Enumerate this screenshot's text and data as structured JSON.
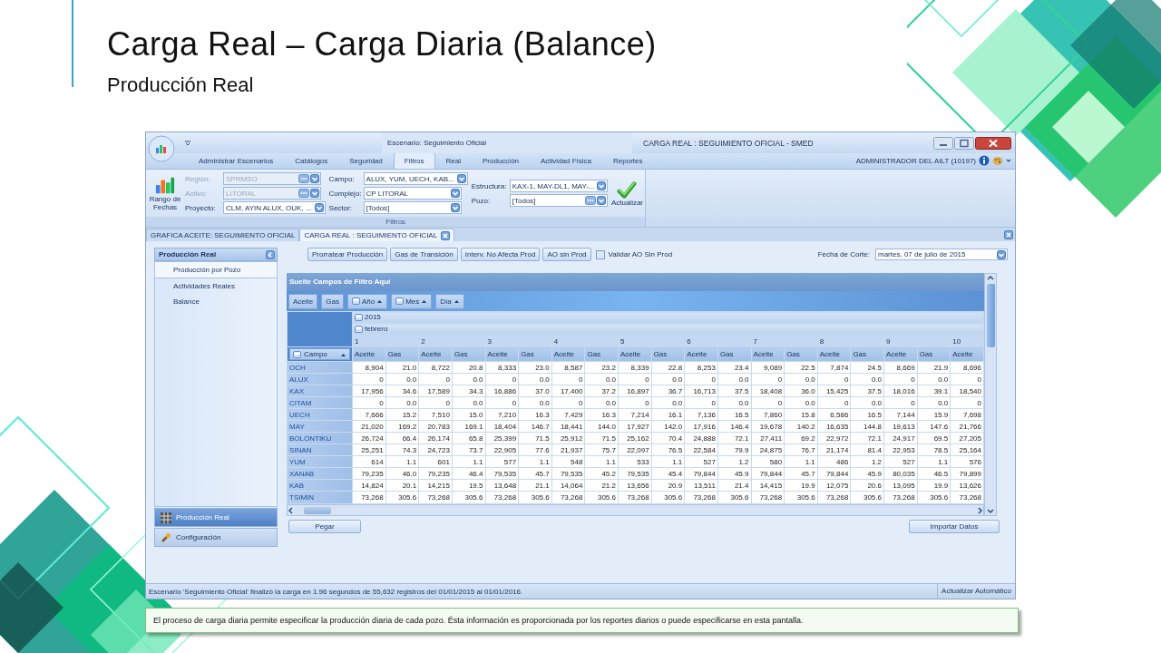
{
  "slide": {
    "title": "Carga Real – Carga Diaria (Balance)",
    "subtitle": "Producción Real"
  },
  "window": {
    "scenario": "Escenario: Seguimiento Oficial",
    "title": "CARGA REAL : SEGUIMIENTO OFICIAL - SMED"
  },
  "ribbon_tabs": [
    {
      "label": "Administrar Escenarios",
      "selected": false
    },
    {
      "label": "Catálogos",
      "selected": false
    },
    {
      "label": "Seguridad",
      "selected": false
    },
    {
      "label": "Filtros",
      "selected": true
    },
    {
      "label": "Real",
      "selected": false
    },
    {
      "label": "Producción",
      "selected": false
    },
    {
      "label": "Actividad Física",
      "selected": false
    },
    {
      "label": "Reportes",
      "selected": false
    }
  ],
  "user": "ADMINISTRADOR DEL AILT (10197)",
  "filters": {
    "date_range_button": "Rango de Fechas",
    "group_label": "Filtros",
    "update_button": "Actualizar",
    "columns": [
      [
        {
          "label": "Región:",
          "value": "SPRMSO",
          "kind": "lookup",
          "disabled": true
        },
        {
          "label": "Activo:",
          "value": "LITORAL",
          "kind": "lookup",
          "disabled": true
        },
        {
          "label": "Proyecto:",
          "value": "CLM, AYIN ALUX, OUK, ...",
          "kind": "combo",
          "disabled": false
        }
      ],
      [
        {
          "label": "Campo:",
          "value": "ALUX, YUM, UECH, KAB...",
          "kind": "combo",
          "disabled": false
        },
        {
          "label": "Complejo:",
          "value": "CP LITORAL",
          "kind": "combo",
          "disabled": false
        },
        {
          "label": "Sector:",
          "value": "[Todos]",
          "kind": "combo",
          "disabled": false
        }
      ],
      [
        {
          "label": "Estructura:",
          "value": "KAX-1, MAY-DL1, MAY-...",
          "kind": "combo",
          "disabled": false
        },
        {
          "label": "Pozo:",
          "value": "[Todos]",
          "kind": "lookup",
          "disabled": false
        }
      ]
    ]
  },
  "doc_tabs": [
    {
      "label": "GRAFICA ACEITE: SEGUIMIENTO OFICIAL",
      "selected": false,
      "closable": false
    },
    {
      "label": "CARGA REAL : SEGUIMIENTO OFICIAL",
      "selected": true,
      "closable": true
    }
  ],
  "sidebar": {
    "header": "Producción Real",
    "items": [
      {
        "label": "Producción por Pozo",
        "selected": true
      },
      {
        "label": "Actividades Reales",
        "selected": false
      },
      {
        "label": "Balance",
        "selected": false
      }
    ],
    "sections": [
      {
        "label": "Producción Real",
        "selected": true,
        "kind": "grid"
      },
      {
        "label": "Configuración",
        "selected": false,
        "kind": "tools"
      }
    ]
  },
  "toolbar": {
    "buttons": [
      "Prorratear Producción",
      "Gas de Transición",
      "Interv. No Afecta Prod",
      "AO sin Prod"
    ],
    "checkbox": {
      "label": "Validar AO Sin Prod",
      "checked": false
    },
    "cutoff": {
      "label": "Fecha de Corte:",
      "value": "martes, 07 de julio de 2015"
    }
  },
  "pivot": {
    "filter_area": "Suelte Campos de Filtro Aquí",
    "data_fields": [
      "Aceite",
      "Gas"
    ],
    "column_fields": [
      {
        "label": "Año",
        "kind": "group"
      },
      {
        "label": "Mes",
        "kind": "group"
      },
      {
        "label": "Día",
        "kind": "plain"
      }
    ],
    "year": "2015",
    "month": "febrero",
    "row_field": "Campo",
    "day_groups": [
      {
        "label": "1",
        "columns": [
          "Aceite",
          "Gas"
        ]
      },
      {
        "label": "2",
        "columns": [
          "Aceite",
          "Gas"
        ]
      },
      {
        "label": "3",
        "columns": [
          "Aceite",
          "Gas"
        ]
      },
      {
        "label": "4",
        "columns": [
          "Aceite",
          "Gas"
        ]
      },
      {
        "label": "5",
        "columns": [
          "Aceite",
          "Gas"
        ]
      },
      {
        "label": "6",
        "columns": [
          "Aceite",
          "Gas"
        ]
      },
      {
        "label": "7",
        "columns": [
          "Aceite",
          "Gas"
        ]
      },
      {
        "label": "8",
        "columns": [
          "Aceite",
          "Gas"
        ]
      },
      {
        "label": "9",
        "columns": [
          "Aceite",
          "Gas"
        ]
      },
      {
        "label": "10",
        "columns": [
          "Aceite"
        ]
      }
    ],
    "rows": [
      {
        "campo": "OCH",
        "cells": [
          "8,904",
          "21.0",
          "8,722",
          "20.8",
          "8,333",
          "23.0",
          "8,587",
          "23.2",
          "8,339",
          "22.8",
          "8,253",
          "23.4",
          "9,089",
          "22.5",
          "7,874",
          "24.5",
          "8,669",
          "21.9",
          "8,696"
        ]
      },
      {
        "campo": "ALUX",
        "cells": [
          "0",
          "0.0",
          "0",
          "0.0",
          "0",
          "0.0",
          "0",
          "0.0",
          "0",
          "0.0",
          "0",
          "0.0",
          "0",
          "0.0",
          "0",
          "0.0",
          "0",
          "0.0",
          "0"
        ]
      },
      {
        "campo": "KAX",
        "cells": [
          "17,956",
          "34.6",
          "17,589",
          "34.3",
          "16,886",
          "37.0",
          "17,400",
          "37.2",
          "16,897",
          "36.7",
          "16,713",
          "37.5",
          "18,408",
          "36.0",
          "15,425",
          "37.5",
          "18,016",
          "39.1",
          "18,540"
        ]
      },
      {
        "campo": "CITAM",
        "cells": [
          "0",
          "0.0",
          "0",
          "0.0",
          "0",
          "0.0",
          "0",
          "0.0",
          "0",
          "0.0",
          "0",
          "0.0",
          "0",
          "0.0",
          "0",
          "0.0",
          "0",
          "0.0",
          "0"
        ]
      },
      {
        "campo": "UECH",
        "cells": [
          "7,666",
          "15.2",
          "7,510",
          "15.0",
          "7,210",
          "16.3",
          "7,429",
          "16.3",
          "7,214",
          "16.1",
          "7,136",
          "16.5",
          "7,860",
          "15.8",
          "6,586",
          "16.5",
          "7,144",
          "15.9",
          "7,698"
        ]
      },
      {
        "campo": "MAY",
        "cells": [
          "21,020",
          "169.2",
          "20,783",
          "169.1",
          "18,404",
          "146.7",
          "18,441",
          "144.0",
          "17,927",
          "142.0",
          "17,916",
          "146.4",
          "19,678",
          "140.2",
          "16,635",
          "144.8",
          "19,613",
          "147.6",
          "21,766"
        ]
      },
      {
        "campo": "BOLONTIKU",
        "cells": [
          "26,724",
          "66.4",
          "26,174",
          "65.8",
          "25,399",
          "71.5",
          "25,912",
          "71.5",
          "25,162",
          "70.4",
          "24,888",
          "72.1",
          "27,411",
          "69.2",
          "22,972",
          "72.1",
          "24,917",
          "69.5",
          "27,205"
        ]
      },
      {
        "campo": "SINAN",
        "cells": [
          "25,251",
          "74.3",
          "24,723",
          "73.7",
          "22,905",
          "77.6",
          "21,937",
          "75.7",
          "22,097",
          "76.5",
          "22,584",
          "79.9",
          "24,875",
          "76.7",
          "21,174",
          "81.4",
          "22,953",
          "78.5",
          "25,164"
        ]
      },
      {
        "campo": "YUM",
        "cells": [
          "614",
          "1.1",
          "601",
          "1.1",
          "577",
          "1.1",
          "548",
          "1.1",
          "533",
          "1.1",
          "527",
          "1.2",
          "580",
          "1.1",
          "486",
          "1.2",
          "527",
          "1.1",
          "576"
        ]
      },
      {
        "campo": "XANAB",
        "cells": [
          "79,235",
          "46.0",
          "79,235",
          "46.4",
          "79,535",
          "45.7",
          "79,535",
          "45.2",
          "79,535",
          "45.4",
          "79,844",
          "45.9",
          "79,844",
          "45.7",
          "79,844",
          "45.9",
          "80,035",
          "46.5",
          "79,899"
        ]
      },
      {
        "campo": "KAB",
        "cells": [
          "14,824",
          "20.1",
          "14,215",
          "19.5",
          "13,648",
          "21.1",
          "14,064",
          "21.2",
          "13,656",
          "20.9",
          "13,511",
          "21.4",
          "14,415",
          "19.9",
          "12,075",
          "20.6",
          "13,095",
          "19.9",
          "13,626"
        ]
      },
      {
        "campo": "TSIMIN",
        "cells": [
          "73,268",
          "305.6",
          "73,268",
          "305.6",
          "73,268",
          "305.6",
          "73,268",
          "305.6",
          "73,268",
          "305.6",
          "73,268",
          "305.6",
          "73,268",
          "305.6",
          "73,268",
          "305.6",
          "73,268",
          "305.6",
          "73,268"
        ]
      }
    ]
  },
  "bottom_buttons": [
    "Pegar",
    "Importar Datos"
  ],
  "status_bar": {
    "message": "Escenario 'Seguimiento Oficial' finalizó la carga en 1.96 segundos de 55,632 registros del 01/01/2015 al 01/01/2016.",
    "mode": "Actualizar Automático"
  },
  "caption": "El proceso de carga diaria permite especificar la producción diaria de cada pozo. Ésta información es proporcionada por los reportes diarios o puede especificarse en esta pantalla."
}
